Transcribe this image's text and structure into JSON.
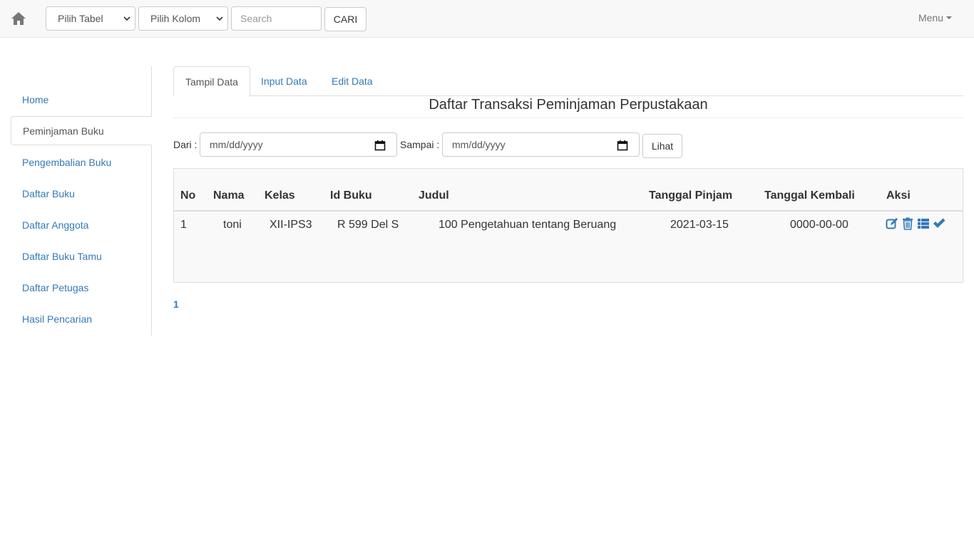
{
  "navbar": {
    "table_select": "Pilih Tabel",
    "column_select": "Pilih Kolom",
    "search_placeholder": "Search",
    "search_button": "CARI",
    "menu_label": "Menu"
  },
  "sidebar": {
    "items": [
      {
        "label": "Home"
      },
      {
        "label": "Peminjaman Buku"
      },
      {
        "label": "Pengembalian Buku"
      },
      {
        "label": "Daftar Buku"
      },
      {
        "label": "Daftar Anggota"
      },
      {
        "label": "Daftar Buku Tamu"
      },
      {
        "label": "Daftar Petugas"
      },
      {
        "label": "Hasil Pencarian"
      }
    ]
  },
  "tabs": [
    {
      "label": "Tampil Data"
    },
    {
      "label": "Input Data"
    },
    {
      "label": "Edit Data"
    }
  ],
  "page_title": "Daftar Transaksi Peminjaman Perpustakaan",
  "filter": {
    "from_label": "Dari :",
    "from_placeholder": "mm/dd/yyyy",
    "to_label": "Sampai :",
    "to_placeholder": "mm/dd/yyyy",
    "button": "Lihat"
  },
  "table": {
    "headers": [
      "No",
      "Nama",
      "Kelas",
      "Id Buku",
      "Judul",
      "Tanggal Pinjam",
      "Tanggal Kembali",
      "Aksi"
    ],
    "rows": [
      [
        "1",
        "toni",
        "XII-IPS3",
        "R 599 Del S",
        "100 Pengetahuan tentang Beruang",
        "2021-03-15",
        "0000-00-00"
      ]
    ]
  },
  "pagination": {
    "current": "1"
  },
  "colors": {
    "link": "#337ab7",
    "navbar_bg": "#f8f8f8"
  }
}
